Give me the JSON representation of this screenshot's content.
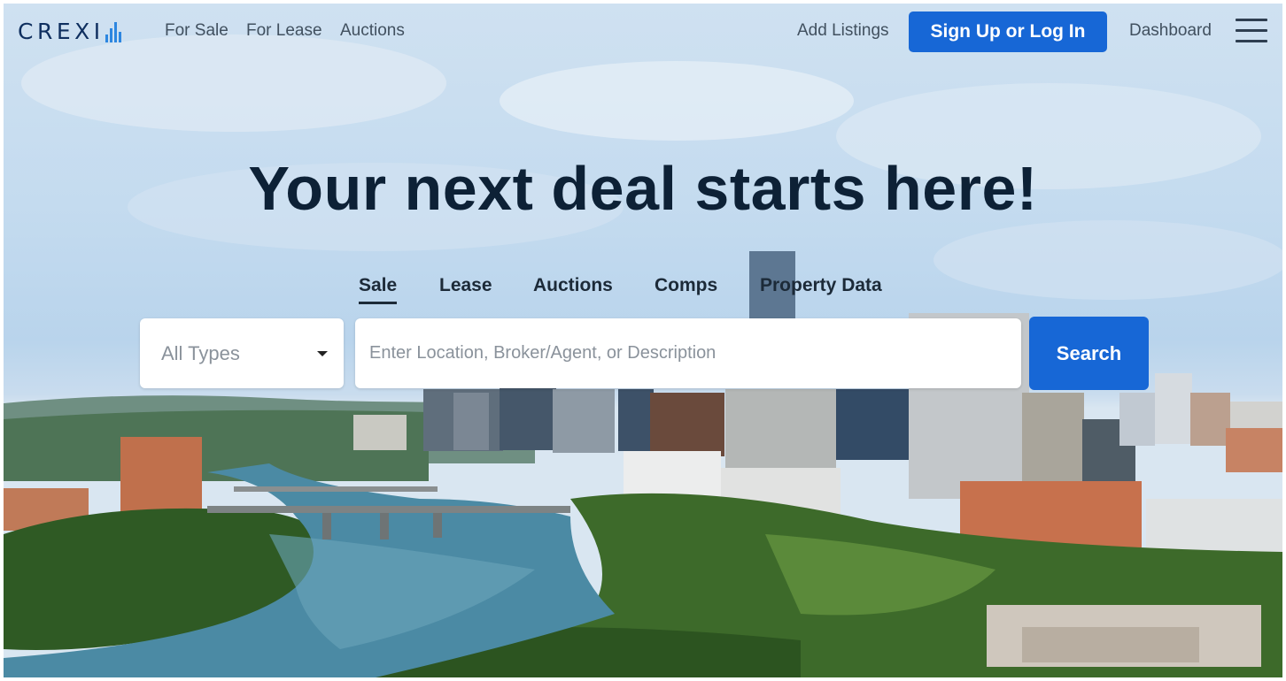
{
  "brand": {
    "name": "CREXI",
    "accent": "#2d86e0",
    "text_color": "#0f2f5f"
  },
  "nav": {
    "links": [
      "For Sale",
      "For Lease",
      "Auctions"
    ],
    "add_listings": "Add Listings",
    "signup": "Sign Up or Log In",
    "dashboard": "Dashboard",
    "menu_icon": "hamburger-icon"
  },
  "hero": {
    "headline": "Your next deal starts here!"
  },
  "search": {
    "tabs": [
      "Sale",
      "Lease",
      "Auctions",
      "Comps",
      "Property Data"
    ],
    "active_tab": "Sale",
    "type_select": "All Types",
    "placeholder": "Enter Location, Broker/Agent, or Description",
    "button": "Search"
  },
  "colors": {
    "primary": "#1767d6",
    "headline": "#0d2136"
  }
}
